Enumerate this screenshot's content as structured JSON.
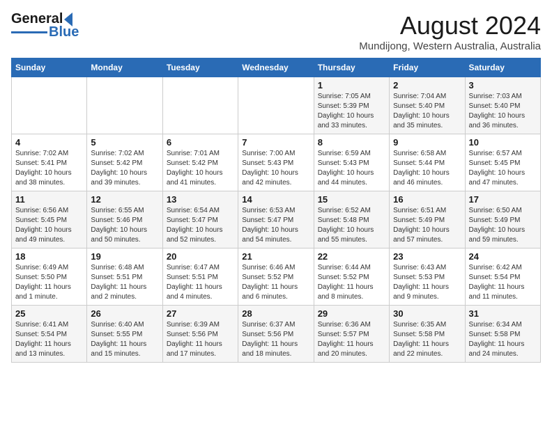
{
  "header": {
    "logo_line1": "General",
    "logo_line2": "Blue",
    "title": "August 2024",
    "subtitle": "Mundijong, Western Australia, Australia"
  },
  "calendar": {
    "columns": [
      "Sunday",
      "Monday",
      "Tuesday",
      "Wednesday",
      "Thursday",
      "Friday",
      "Saturday"
    ],
    "weeks": [
      [
        {
          "day": "",
          "info": ""
        },
        {
          "day": "",
          "info": ""
        },
        {
          "day": "",
          "info": ""
        },
        {
          "day": "",
          "info": ""
        },
        {
          "day": "1",
          "info": "Sunrise: 7:05 AM\nSunset: 5:39 PM\nDaylight: 10 hours\nand 33 minutes."
        },
        {
          "day": "2",
          "info": "Sunrise: 7:04 AM\nSunset: 5:40 PM\nDaylight: 10 hours\nand 35 minutes."
        },
        {
          "day": "3",
          "info": "Sunrise: 7:03 AM\nSunset: 5:40 PM\nDaylight: 10 hours\nand 36 minutes."
        }
      ],
      [
        {
          "day": "4",
          "info": "Sunrise: 7:02 AM\nSunset: 5:41 PM\nDaylight: 10 hours\nand 38 minutes."
        },
        {
          "day": "5",
          "info": "Sunrise: 7:02 AM\nSunset: 5:42 PM\nDaylight: 10 hours\nand 39 minutes."
        },
        {
          "day": "6",
          "info": "Sunrise: 7:01 AM\nSunset: 5:42 PM\nDaylight: 10 hours\nand 41 minutes."
        },
        {
          "day": "7",
          "info": "Sunrise: 7:00 AM\nSunset: 5:43 PM\nDaylight: 10 hours\nand 42 minutes."
        },
        {
          "day": "8",
          "info": "Sunrise: 6:59 AM\nSunset: 5:43 PM\nDaylight: 10 hours\nand 44 minutes."
        },
        {
          "day": "9",
          "info": "Sunrise: 6:58 AM\nSunset: 5:44 PM\nDaylight: 10 hours\nand 46 minutes."
        },
        {
          "day": "10",
          "info": "Sunrise: 6:57 AM\nSunset: 5:45 PM\nDaylight: 10 hours\nand 47 minutes."
        }
      ],
      [
        {
          "day": "11",
          "info": "Sunrise: 6:56 AM\nSunset: 5:45 PM\nDaylight: 10 hours\nand 49 minutes."
        },
        {
          "day": "12",
          "info": "Sunrise: 6:55 AM\nSunset: 5:46 PM\nDaylight: 10 hours\nand 50 minutes."
        },
        {
          "day": "13",
          "info": "Sunrise: 6:54 AM\nSunset: 5:47 PM\nDaylight: 10 hours\nand 52 minutes."
        },
        {
          "day": "14",
          "info": "Sunrise: 6:53 AM\nSunset: 5:47 PM\nDaylight: 10 hours\nand 54 minutes."
        },
        {
          "day": "15",
          "info": "Sunrise: 6:52 AM\nSunset: 5:48 PM\nDaylight: 10 hours\nand 55 minutes."
        },
        {
          "day": "16",
          "info": "Sunrise: 6:51 AM\nSunset: 5:49 PM\nDaylight: 10 hours\nand 57 minutes."
        },
        {
          "day": "17",
          "info": "Sunrise: 6:50 AM\nSunset: 5:49 PM\nDaylight: 10 hours\nand 59 minutes."
        }
      ],
      [
        {
          "day": "18",
          "info": "Sunrise: 6:49 AM\nSunset: 5:50 PM\nDaylight: 11 hours\nand 1 minute."
        },
        {
          "day": "19",
          "info": "Sunrise: 6:48 AM\nSunset: 5:51 PM\nDaylight: 11 hours\nand 2 minutes."
        },
        {
          "day": "20",
          "info": "Sunrise: 6:47 AM\nSunset: 5:51 PM\nDaylight: 11 hours\nand 4 minutes."
        },
        {
          "day": "21",
          "info": "Sunrise: 6:46 AM\nSunset: 5:52 PM\nDaylight: 11 hours\nand 6 minutes."
        },
        {
          "day": "22",
          "info": "Sunrise: 6:44 AM\nSunset: 5:52 PM\nDaylight: 11 hours\nand 8 minutes."
        },
        {
          "day": "23",
          "info": "Sunrise: 6:43 AM\nSunset: 5:53 PM\nDaylight: 11 hours\nand 9 minutes."
        },
        {
          "day": "24",
          "info": "Sunrise: 6:42 AM\nSunset: 5:54 PM\nDaylight: 11 hours\nand 11 minutes."
        }
      ],
      [
        {
          "day": "25",
          "info": "Sunrise: 6:41 AM\nSunset: 5:54 PM\nDaylight: 11 hours\nand 13 minutes."
        },
        {
          "day": "26",
          "info": "Sunrise: 6:40 AM\nSunset: 5:55 PM\nDaylight: 11 hours\nand 15 minutes."
        },
        {
          "day": "27",
          "info": "Sunrise: 6:39 AM\nSunset: 5:56 PM\nDaylight: 11 hours\nand 17 minutes."
        },
        {
          "day": "28",
          "info": "Sunrise: 6:37 AM\nSunset: 5:56 PM\nDaylight: 11 hours\nand 18 minutes."
        },
        {
          "day": "29",
          "info": "Sunrise: 6:36 AM\nSunset: 5:57 PM\nDaylight: 11 hours\nand 20 minutes."
        },
        {
          "day": "30",
          "info": "Sunrise: 6:35 AM\nSunset: 5:58 PM\nDaylight: 11 hours\nand 22 minutes."
        },
        {
          "day": "31",
          "info": "Sunrise: 6:34 AM\nSunset: 5:58 PM\nDaylight: 11 hours\nand 24 minutes."
        }
      ]
    ]
  }
}
